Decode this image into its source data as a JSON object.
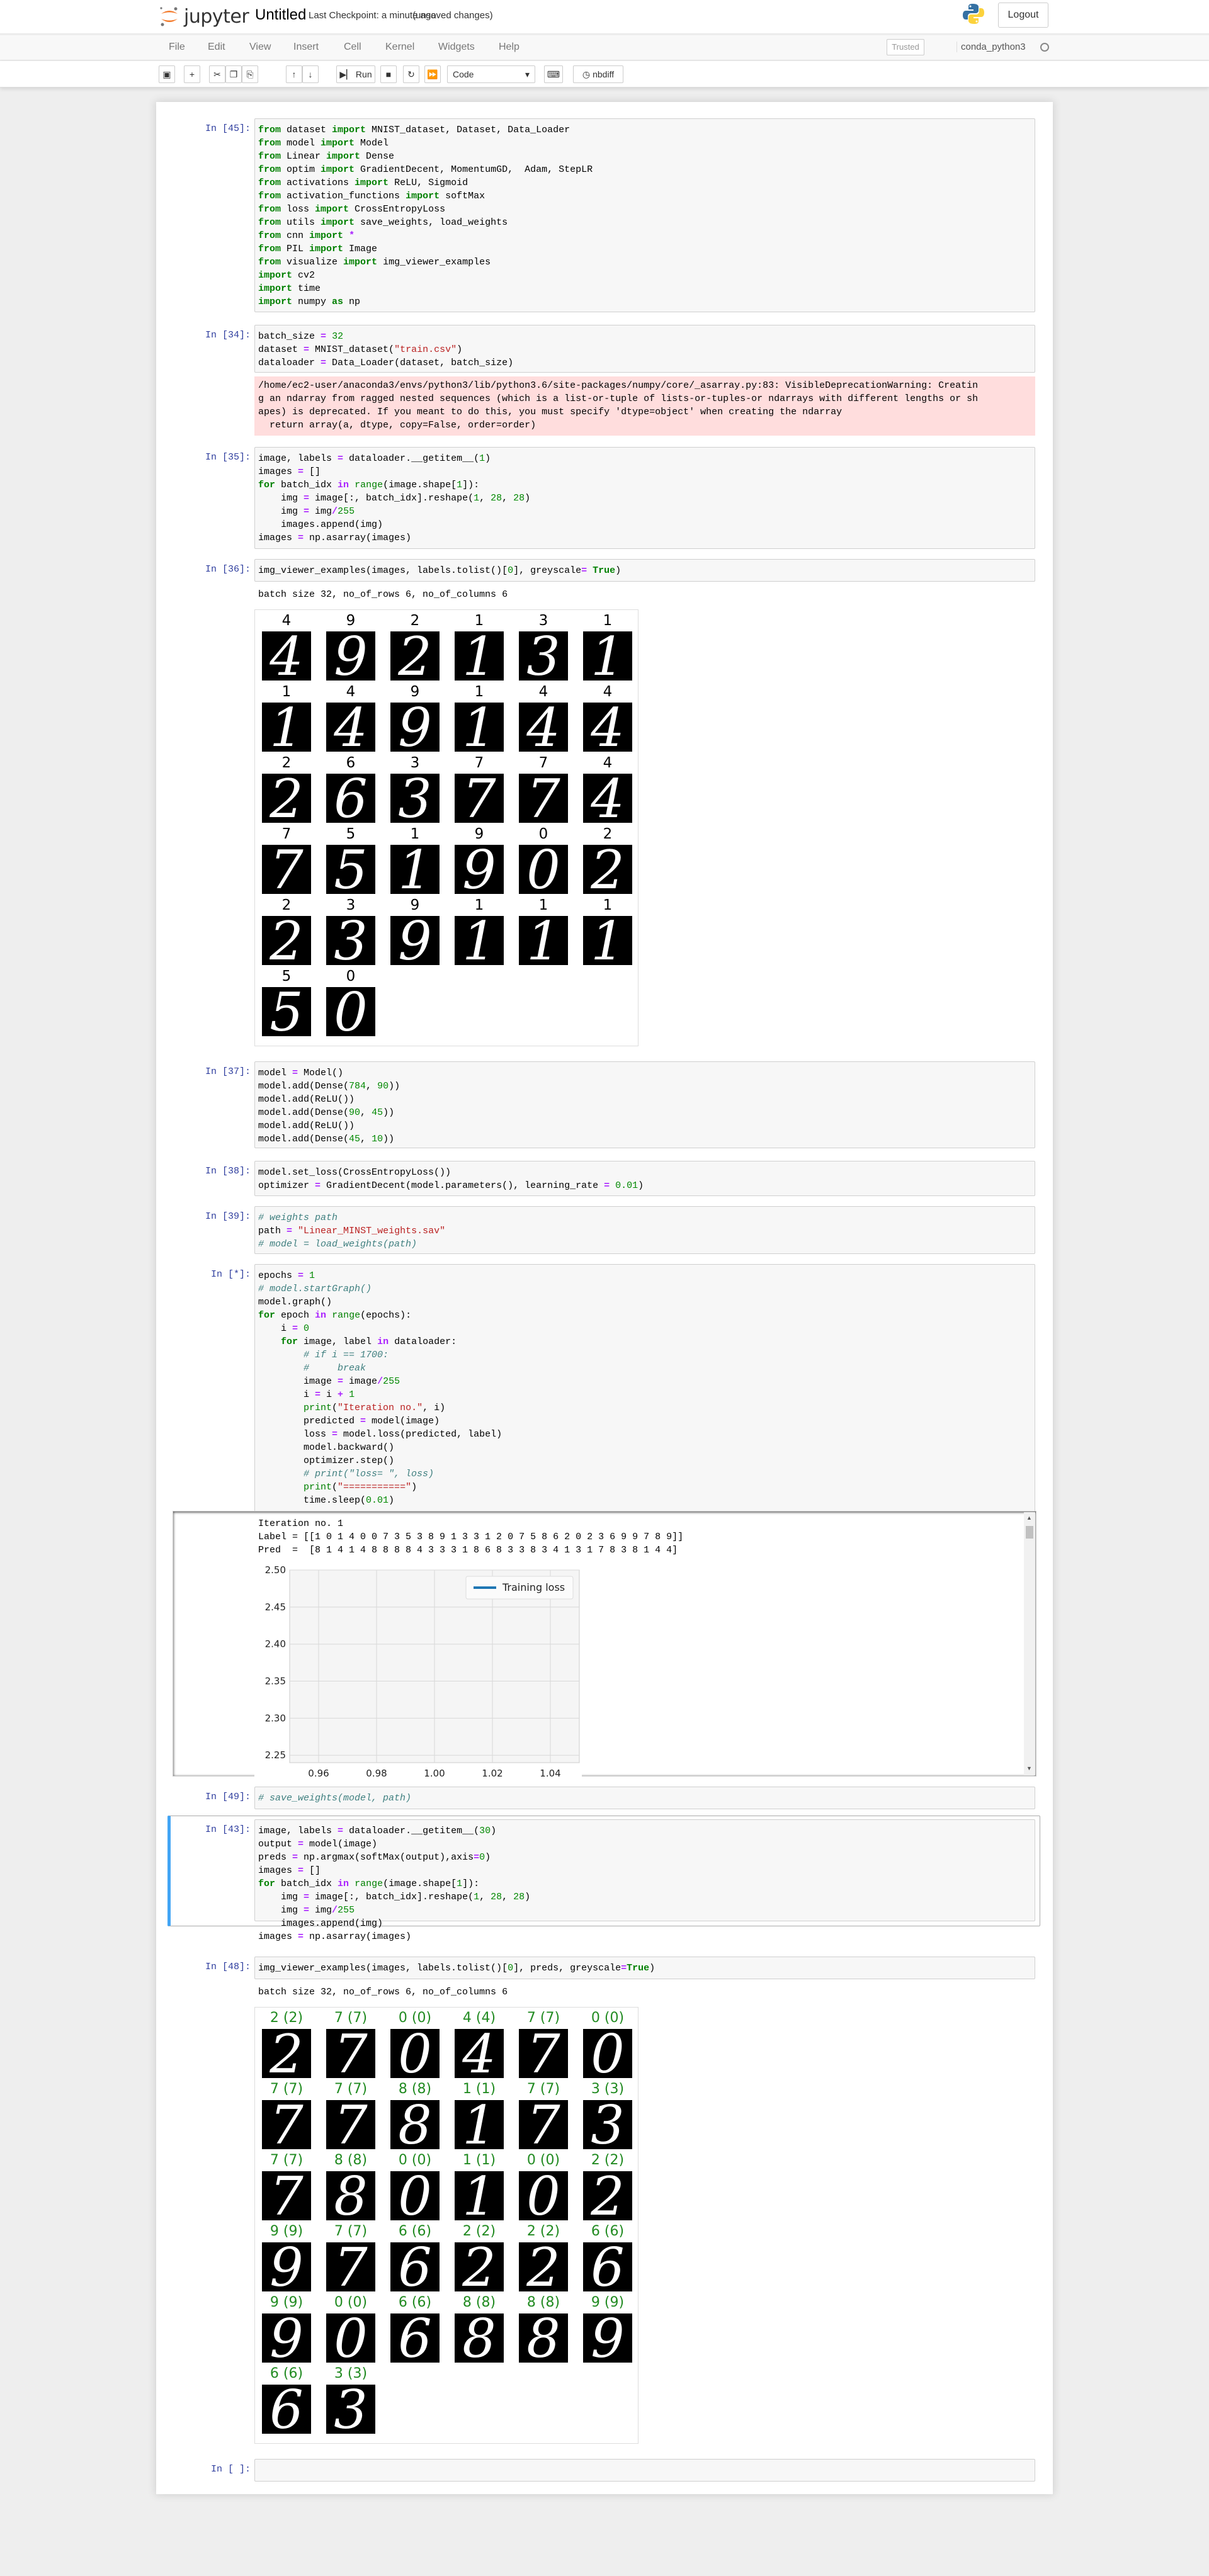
{
  "header": {
    "logo_text": "jupyter",
    "notebook_name": "Untitled",
    "checkpoint": "Last Checkpoint: a minute ago",
    "autosave": "(unsaved changes)",
    "logout_label": "Logout"
  },
  "menu": [
    "File",
    "Edit",
    "View",
    "Insert",
    "Cell",
    "Kernel",
    "Widgets",
    "Help"
  ],
  "status": {
    "trusted": "Trusted",
    "kernel": "conda_python3"
  },
  "toolbar": {
    "run_label": "Run",
    "cell_type": "Code",
    "nbdiff_label": "nbdiff"
  },
  "cells": {
    "c1": {
      "prompt": "In [45]:"
    },
    "c2": {
      "prompt": "In [34]:",
      "warning": "/home/ec2-user/anaconda3/envs/python3/lib/python3.6/site-packages/numpy/core/_asarray.py:83: VisibleDeprecationWarning: Creatin\ng an ndarray from ragged nested sequences (which is a list-or-tuple of lists-or-tuples-or ndarrays with different lengths or sh\napes) is deprecated. If you meant to do this, you must specify 'dtype=object' when creating the ndarray\n  return array(a, dtype, copy=False, order=order)"
    },
    "c3": {
      "prompt": "In [35]:"
    },
    "c4": {
      "prompt": "In [36]:",
      "output": "batch size 32, no_of_rows 6, no_of_columns 6"
    },
    "c5": {
      "prompt": "In [37]:"
    },
    "c6": {
      "prompt": "In [38]:"
    },
    "c7": {
      "prompt": "In [39]:"
    },
    "c8": {
      "prompt": "In [*]:",
      "output": "Iteration no. 1\nLabel = [[1 0 1 4 0 0 7 3 5 3 8 9 1 3 3 1 2 0 7 5 8 6 2 0 2 3 6 9 9 7 8 9]]\nPred  =  [8 1 4 1 4 8 8 8 8 4 3 3 3 1 8 6 8 3 3 8 3 4 1 3 1 7 8 3 8 1 4 4]"
    },
    "c9": {
      "prompt": "In [49]:"
    },
    "c10": {
      "prompt": "In [43]:"
    },
    "c11": {
      "prompt": "In [48]:",
      "output": "batch size 32, no_of_rows 6, no_of_columns 6"
    },
    "c12": {
      "prompt": "In [ ]:"
    }
  },
  "grid1": {
    "labels": [
      "4",
      "9",
      "2",
      "1",
      "3",
      "1",
      "1",
      "4",
      "9",
      "1",
      "4",
      "4",
      "2",
      "6",
      "3",
      "7",
      "7",
      "4",
      "7",
      "5",
      "1",
      "9",
      "0",
      "2",
      "2",
      "3",
      "9",
      "1",
      "1",
      "1",
      "5",
      "0"
    ]
  },
  "grid2": {
    "labels": [
      "2 (2)",
      "7 (7)",
      "0 (0)",
      "4 (4)",
      "7 (7)",
      "0 (0)",
      "7 (7)",
      "7 (7)",
      "8 (8)",
      "1 (1)",
      "7 (7)",
      "3 (3)",
      "7 (7)",
      "8 (8)",
      "0 (0)",
      "1 (1)",
      "0 (0)",
      "2 (2)",
      "9 (9)",
      "7 (7)",
      "6 (6)",
      "2 (2)",
      "2 (2)",
      "6 (6)",
      "9 (9)",
      "0 (0)",
      "6 (6)",
      "8 (8)",
      "8 (8)",
      "9 (9)",
      "6 (6)",
      "3 (3)"
    ],
    "digits": [
      "2",
      "7",
      "0",
      "4",
      "7",
      "0",
      "7",
      "7",
      "8",
      "1",
      "7",
      "3",
      "7",
      "8",
      "0",
      "1",
      "0",
      "2",
      "9",
      "7",
      "6",
      "2",
      "2",
      "6",
      "9",
      "0",
      "6",
      "8",
      "8",
      "9",
      "6",
      "3"
    ],
    "label_color": "#228b22"
  },
  "chart_data": {
    "type": "line",
    "series": [
      {
        "name": "Training loss",
        "x": [],
        "y": []
      }
    ],
    "xticks": [
      "0.96",
      "0.98",
      "1.00",
      "1.02",
      "1.04"
    ],
    "yticks": [
      "2.50",
      "2.45",
      "2.40",
      "2.35",
      "2.30",
      "2.25"
    ],
    "xlim": [
      0.95,
      1.05
    ],
    "ylim": [
      2.24,
      2.5
    ],
    "grid": true,
    "legend": "top-right",
    "line_color": "#1f77b4"
  }
}
